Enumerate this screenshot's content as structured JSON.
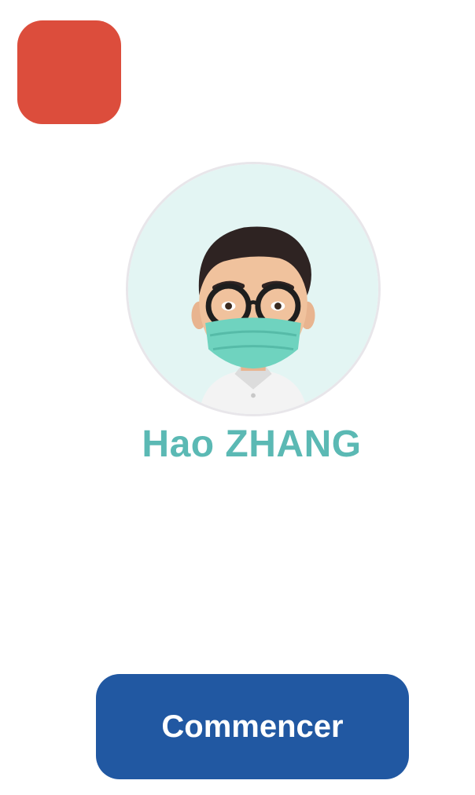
{
  "top_left_square": {
    "color": "#dc4d3c"
  },
  "avatar": {
    "icon": "memoji-avatar-with-mask-icon",
    "background": "#e3f5f3"
  },
  "profile": {
    "name": "Hao ZHANG",
    "name_color": "#5bb9b4"
  },
  "start_button": {
    "label": "Commencer",
    "color": "#2158a2"
  }
}
